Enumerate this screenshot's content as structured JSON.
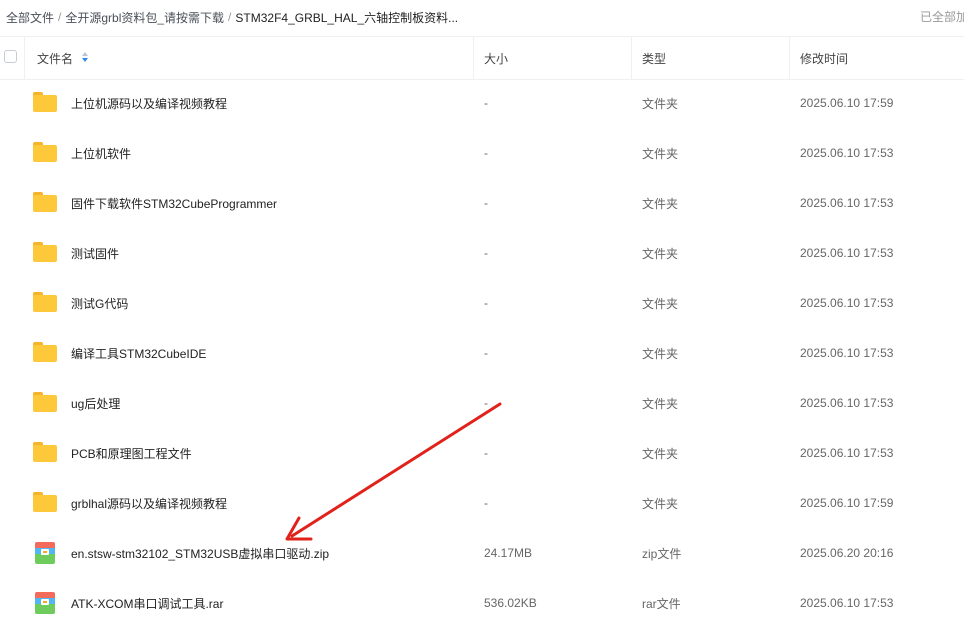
{
  "breadcrumb": {
    "root": "全部文件",
    "level1": "全开源grbl资料包_请按需下载",
    "current": "STM32F4_GRBL_HAL_六轴控制板资料..."
  },
  "status": {
    "all_loaded": "已全部加载"
  },
  "columns": {
    "name": "文件名",
    "size": "大小",
    "type": "类型",
    "modified": "修改时间"
  },
  "files": [
    {
      "name": "上位机源码以及编译视频教程",
      "size": "-",
      "type": "文件夹",
      "modified": "2025.06.10 17:59",
      "icon": "folder-icon"
    },
    {
      "name": "上位机软件",
      "size": "-",
      "type": "文件夹",
      "modified": "2025.06.10 17:53",
      "icon": "folder-icon"
    },
    {
      "name": "固件下载软件STM32CubeProgrammer",
      "size": "-",
      "type": "文件夹",
      "modified": "2025.06.10 17:53",
      "icon": "folder-icon"
    },
    {
      "name": "测试固件",
      "size": "-",
      "type": "文件夹",
      "modified": "2025.06.10 17:53",
      "icon": "folder-icon"
    },
    {
      "name": "测试G代码",
      "size": "-",
      "type": "文件夹",
      "modified": "2025.06.10 17:53",
      "icon": "folder-icon"
    },
    {
      "name": "编译工具STM32CubeIDE",
      "size": "-",
      "type": "文件夹",
      "modified": "2025.06.10 17:53",
      "icon": "folder-icon"
    },
    {
      "name": "ug后处理",
      "size": "-",
      "type": "文件夹",
      "modified": "2025.06.10 17:53",
      "icon": "folder-icon"
    },
    {
      "name": "PCB和原理图工程文件",
      "size": "-",
      "type": "文件夹",
      "modified": "2025.06.10 17:53",
      "icon": "folder-icon"
    },
    {
      "name": "grblhal源码以及编译视频教程",
      "size": "-",
      "type": "文件夹",
      "modified": "2025.06.10 17:59",
      "icon": "folder-icon"
    },
    {
      "name": "en.stsw-stm32102_STM32USB虚拟串口驱动.zip",
      "size": "24.17MB",
      "type": "zip文件",
      "modified": "2025.06.20 20:16",
      "icon": "zip-archive-icon"
    },
    {
      "name": "ATK-XCOM串口调试工具.rar",
      "size": "536.02KB",
      "type": "rar文件",
      "modified": "2025.06.10 17:53",
      "icon": "rar-archive-icon"
    }
  ],
  "annotation": {
    "color": "#e0221b"
  }
}
